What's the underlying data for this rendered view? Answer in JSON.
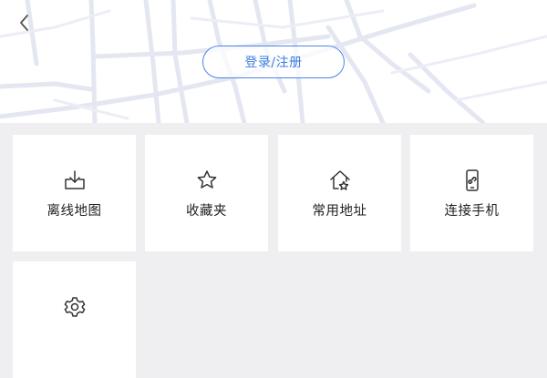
{
  "header": {
    "login_label": "登录/注册"
  },
  "grid": {
    "items": [
      {
        "label": "离线地图",
        "icon": "offline-download-icon"
      },
      {
        "label": "收藏夹",
        "icon": "star-icon"
      },
      {
        "label": "常用地址",
        "icon": "home-star-icon"
      },
      {
        "label": "连接手机",
        "icon": "phone-link-icon"
      },
      {
        "label": "",
        "icon": "gear-icon"
      }
    ]
  },
  "colors": {
    "accent": "#4a86e8",
    "page_background": "#efeff1",
    "tile_background": "#ffffff",
    "map_lines": "#e6e8f2"
  }
}
